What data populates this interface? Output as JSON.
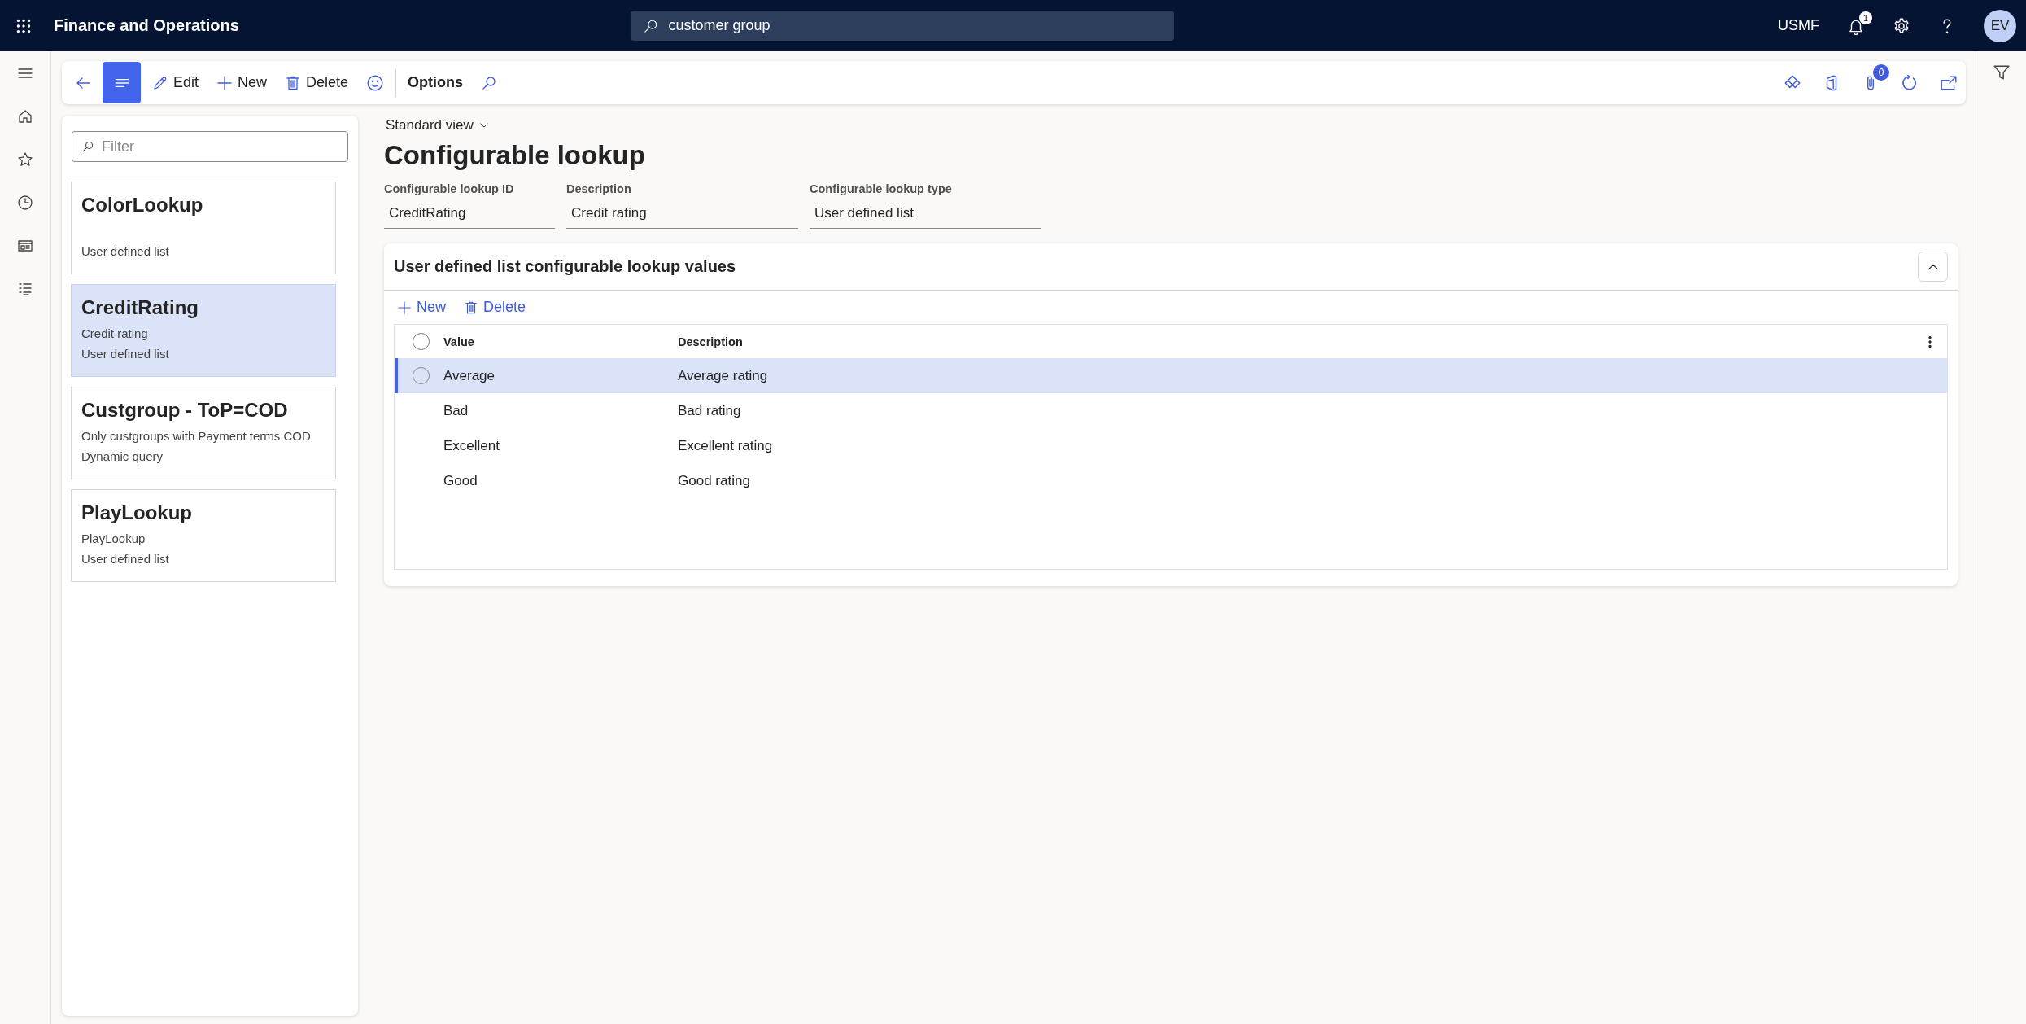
{
  "app_bar": {
    "title": "Finance and Operations",
    "search": {
      "value": "customer group"
    },
    "company": "USMF",
    "notifications": "1",
    "avatar": "EV"
  },
  "action_pane": {
    "list_toggle": {
      "on": true
    },
    "actions": [
      {
        "kind": "edit",
        "label": "Edit"
      },
      {
        "kind": "new",
        "label": "New"
      },
      {
        "kind": "delete",
        "label": "Delete"
      },
      {
        "kind": "feedback"
      }
    ],
    "tabs": [
      {
        "label": "Options",
        "selected": false
      }
    ],
    "attachments": "0"
  },
  "list_panel": {
    "filter": {
      "placeholder": "Filter"
    },
    "items": [
      {
        "title": "ColorLookup",
        "type": "User defined list",
        "selected": false
      },
      {
        "title": "CreditRating",
        "description": "Credit rating",
        "type": "User defined list",
        "selected": true
      },
      {
        "title": "Custgroup - ToP=COD",
        "description": "Only custgroups with Payment terms COD",
        "type": "Dynamic query",
        "selected": false
      },
      {
        "title": "PlayLookup",
        "description": "PlayLookup",
        "type": "User defined list",
        "selected": false
      }
    ]
  },
  "view_selector": "Standard view",
  "title": "Configurable lookup",
  "fields": [
    {
      "label": "Configurable lookup ID",
      "value": "CreditRating"
    },
    {
      "label": "Description",
      "value": "Credit rating"
    },
    {
      "label": "Configurable lookup type",
      "value": "User defined list"
    }
  ],
  "values_section": {
    "title": "User defined list configurable lookup values",
    "expanded": true,
    "toolbar": [
      {
        "kind": "new",
        "label": "New"
      },
      {
        "kind": "delete",
        "label": "Delete"
      }
    ],
    "select_all": {
      "checked": false
    },
    "columns": [
      "Value",
      "Description"
    ],
    "rows": [
      {
        "value": "Average",
        "description": "Average rating",
        "selected": true
      },
      {
        "value": "Bad",
        "description": "Bad rating",
        "selected": false
      },
      {
        "value": "Excellent",
        "description": "Excellent rating",
        "selected": false
      },
      {
        "value": "Good",
        "description": "Good rating",
        "selected": false
      }
    ]
  }
}
